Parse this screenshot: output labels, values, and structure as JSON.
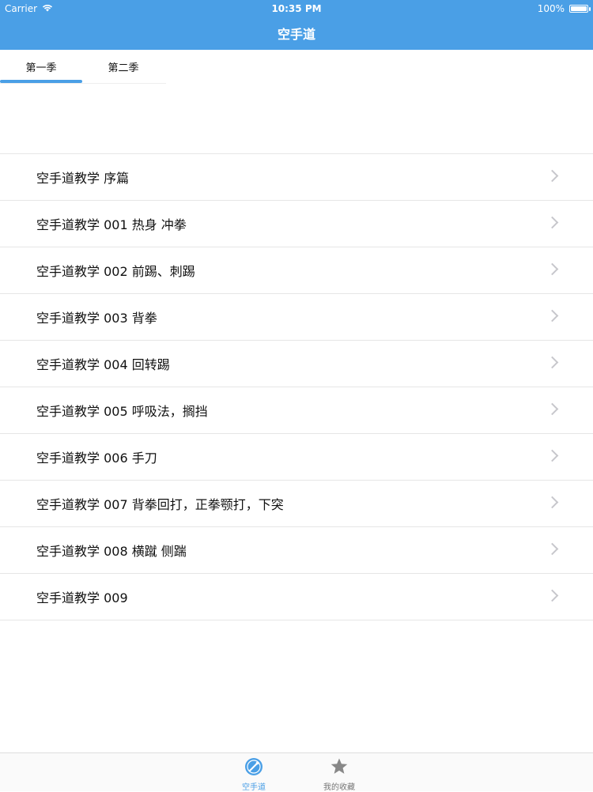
{
  "status_bar": {
    "carrier": "Carrier",
    "time": "10:35 PM",
    "battery_text": "100%",
    "battery_level": 1.0
  },
  "nav": {
    "title": "空手道"
  },
  "segments": {
    "tabs": [
      {
        "label": "第一季",
        "selected": true
      },
      {
        "label": "第二季",
        "selected": false
      }
    ]
  },
  "list": {
    "items": [
      "空手道教学 序篇",
      "空手道教学 001 热身 冲拳",
      "空手道教学 002 前踢、刺踢",
      "空手道教学 003 背拳",
      "空手道教学 004 回转踢",
      "空手道教学 005 呼吸法，搁挡",
      "空手道教学 006 手刀",
      "空手道教学 007 背拳回打，正拳颚打，下突",
      "空手道教学 008 横蹴 侧踹",
      "空手道教学 009"
    ]
  },
  "tabbar": {
    "items": [
      {
        "label": "空手道",
        "icon": "karate-icon",
        "selected": true
      },
      {
        "label": "我的收藏",
        "icon": "star-icon",
        "selected": false
      }
    ]
  },
  "colors": {
    "accent": "#4a9fe6",
    "chevron": "#c7c7cc",
    "separator": "#e6e6e6"
  }
}
